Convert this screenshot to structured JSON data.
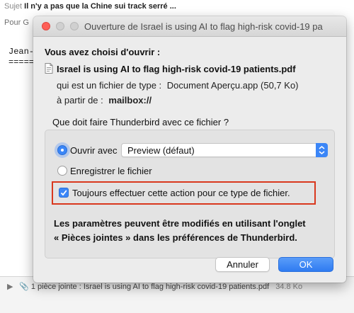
{
  "background": {
    "subject_label": "Sujet",
    "subject_value": "Il n'y a pas que la Chine sui track serré ...",
    "for_label": "Pour",
    "for_value": "G",
    "body_line": "Jean-l",
    "body_rule": "=======",
    "attachment_text": "1 pièce jointe : Israel is using AI to flag high-risk covid-19 patients.pdf",
    "attachment_size": "34.8 Ko"
  },
  "dialog": {
    "title": "Ouverture de Israel is using AI to flag high-risk covid-19 pa",
    "heading": "Vous avez choisi d'ouvrir :",
    "filename": "Israel is using AI to flag high-risk covid-19 patients.pdf",
    "type_label": "qui est un fichier de type :",
    "type_value": "Document Aperçu.app (50,7 Ko)",
    "from_label": "à partir de :",
    "from_value": "mailbox://",
    "question": "Que doit faire Thunderbird avec ce fichier ?",
    "open_with_label": "Ouvrir avec",
    "open_with_selected": "Preview (défaut)",
    "save_label": "Enregistrer le fichier",
    "always_label": "Toujours effectuer cette action pour ce type de fichier.",
    "note_line1": "Les paramètres peuvent être modifiés en utilisant l'onglet",
    "note_line2": "« Pièces jointes » dans les préférences de Thunderbird.",
    "cancel_label": "Annuler",
    "ok_label": "OK"
  },
  "colors": {
    "accent": "#3b86f7",
    "highlight_border": "#d9381e",
    "close_button": "#fe5f57"
  },
  "state": {
    "selected_action": "open_with",
    "always_checked": true
  }
}
